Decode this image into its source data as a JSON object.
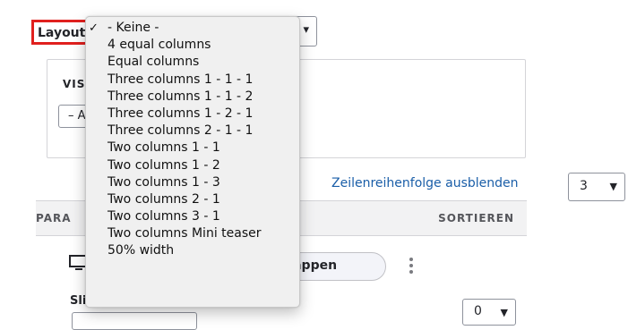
{
  "layout_field": {
    "label": "Layout",
    "options": [
      {
        "label": "- Keine -",
        "selected": true
      },
      {
        "label": "4 equal columns"
      },
      {
        "label": "Equal columns"
      },
      {
        "label": "Three columns 1 - 1 - 1"
      },
      {
        "label": "Three columns 1 - 1 - 2"
      },
      {
        "label": "Three columns 1 - 2 - 1"
      },
      {
        "label": "Three columns 2 - 1 - 1"
      },
      {
        "label": "Two columns 1 - 1"
      },
      {
        "label": "Two columns 1 - 2"
      },
      {
        "label": "Two columns 1 - 3"
      },
      {
        "label": "Two columns 2 - 1"
      },
      {
        "label": "Two columns 3 - 1"
      },
      {
        "label": "Two columns Mini teaser"
      },
      {
        "label": "50% width"
      }
    ],
    "check_glyph": "✓",
    "chevron": "▾"
  },
  "visibility": {
    "label_visible": "VIS",
    "select_value": "– A"
  },
  "row_order_link": "Zeilenreihenfolge ausblenden",
  "per_page": {
    "value": "3",
    "chevron": "▼"
  },
  "table": {
    "col_paragraph": "PARA",
    "col_sort": "SORTIEREN"
  },
  "row": {
    "icon": "monitor-icon",
    "collapse_label": "klappen",
    "slider_label": "Sli",
    "weight_value": "0",
    "weight_chevron": "▼"
  },
  "colors": {
    "highlight_border": "#e0201e",
    "link": "#1a5ea8"
  }
}
